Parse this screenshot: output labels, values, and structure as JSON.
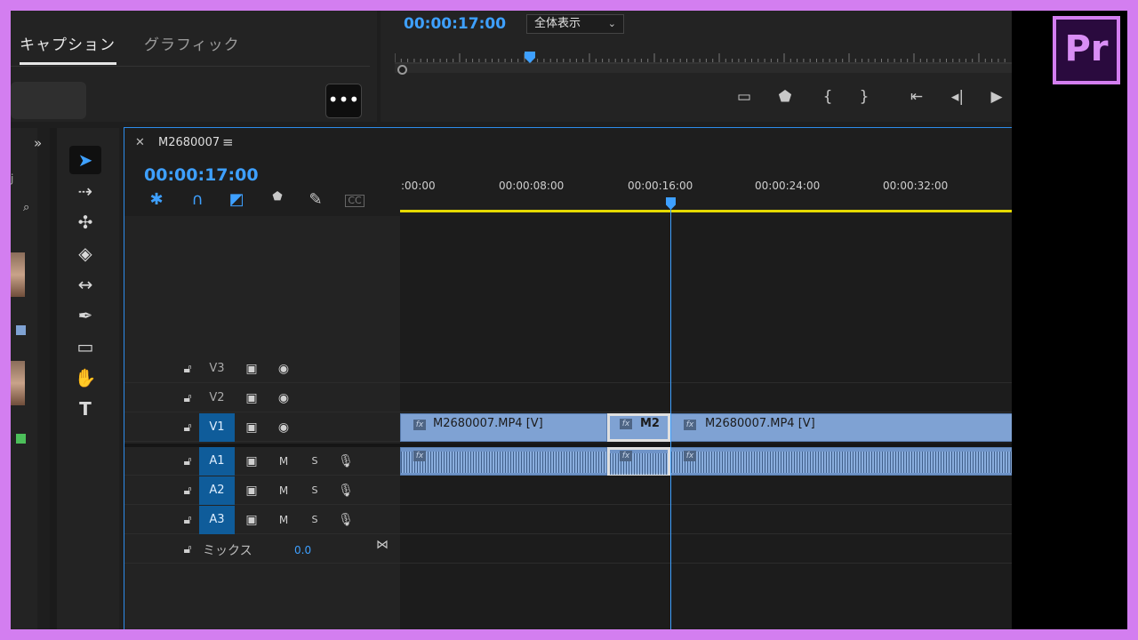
{
  "caption_panel": {
    "tabs": [
      {
        "label": "キャプション"
      },
      {
        "label": "グラフィック"
      }
    ],
    "more_label": "•••"
  },
  "program": {
    "timecode": "00:00:17:00",
    "zoom": "全体表示"
  },
  "sequence": {
    "name": "M2680007",
    "timecode": "00:00:17:00",
    "ruler": [
      ":00:00",
      "00:00:08:00",
      "00:00:16:00",
      "00:00:24:00",
      "00:00:32:00"
    ],
    "video_tracks": [
      {
        "label": "V3"
      },
      {
        "label": "V2"
      },
      {
        "label": "V1"
      }
    ],
    "audio_tracks": [
      {
        "label": "A1"
      },
      {
        "label": "A2"
      },
      {
        "label": "A3"
      }
    ],
    "mute_label": "M",
    "solo_label": "S",
    "mix_label": "ミックス",
    "mix_value": "0.0",
    "clips": {
      "v1_a": "M2680007.MP4 [V]",
      "v1_b": "M2",
      "v1_c": "M2680007.MP4 [V]"
    },
    "fx_label": "fx"
  },
  "logo": "Pr"
}
